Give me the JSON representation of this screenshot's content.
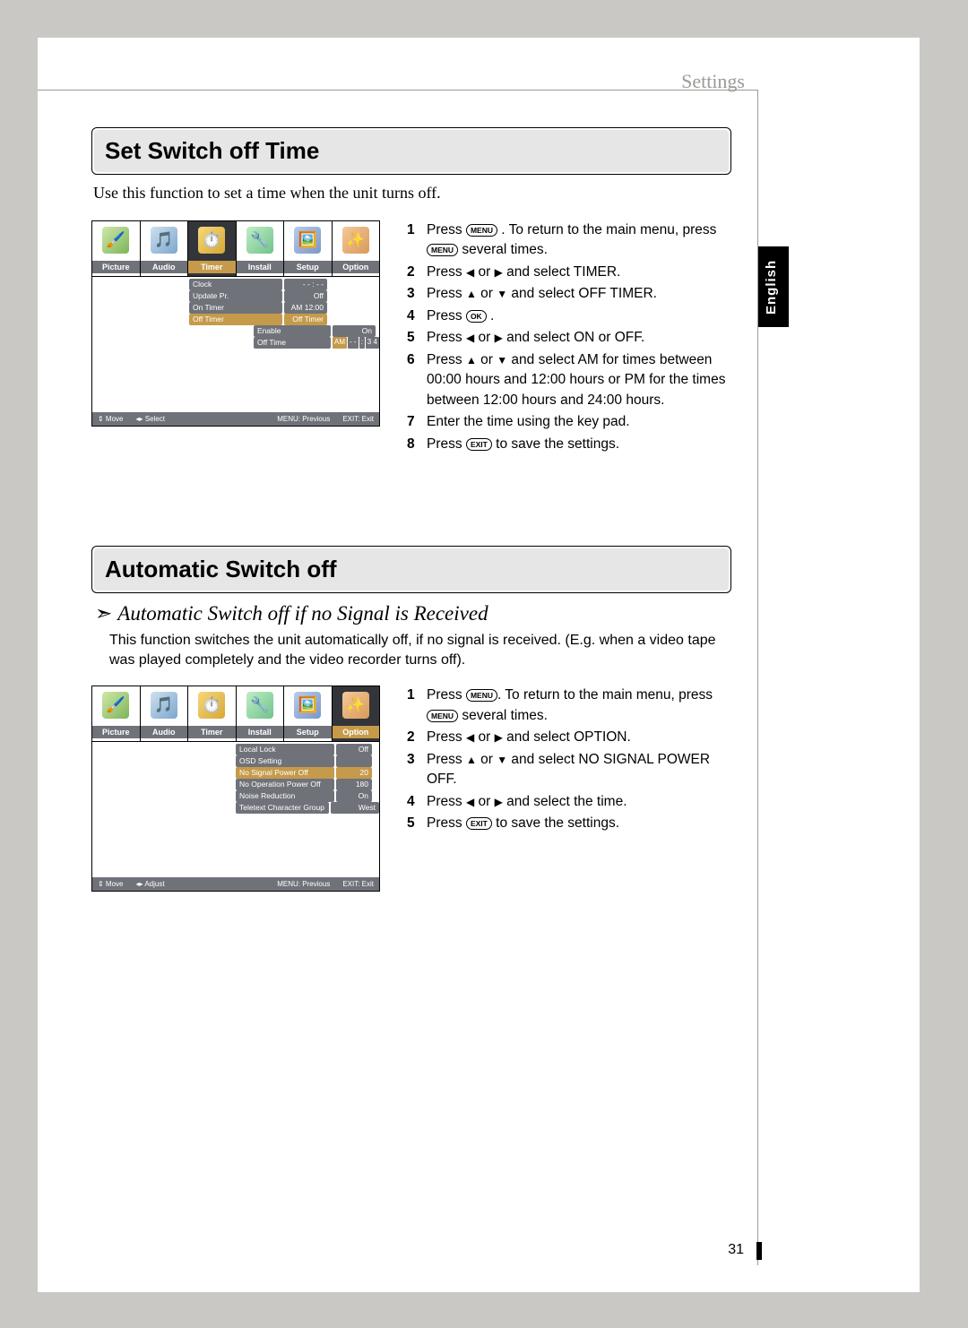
{
  "header": {
    "section": "Settings",
    "language": "English",
    "page_number": "31"
  },
  "section1": {
    "title": "Set Switch off Time",
    "intro": "Use this function to set a time when the unit turns off.",
    "osd": {
      "tabs": [
        "Picture",
        "Audio",
        "Timer",
        "Install",
        "Setup",
        "Option"
      ],
      "active_tab": 2,
      "rows": [
        {
          "label": "Clock",
          "value": "- - : - -"
        },
        {
          "label": "Update Pr.",
          "value": "Off"
        },
        {
          "label": "On Timer",
          "value": "AM 12:00"
        },
        {
          "label": "Off Timer",
          "value": "Off Timer",
          "hl": true
        }
      ],
      "subrows": [
        {
          "label": "Enable",
          "value": "On"
        },
        {
          "label": "Off Time",
          "pieces": [
            "AM",
            "- -",
            ":",
            "3 4"
          ]
        }
      ],
      "footer": [
        "⇕ Move",
        "◂▸ Select",
        "MENU: Previous",
        "EXIT: Exit"
      ]
    },
    "steps": [
      {
        "n": "1",
        "t": "Press |MENU| . To return to the main menu, press |MENU| several times."
      },
      {
        "n": "2",
        "t": "Press ◀ or ▶ and select TIMER."
      },
      {
        "n": "3",
        "t": "Press ▲ or ▼ and select OFF TIMER."
      },
      {
        "n": "4",
        "t": "Press |OK| ."
      },
      {
        "n": "5",
        "t": "Press ◀ or ▶ and select ON or OFF."
      },
      {
        "n": "6",
        "t": "Press ▲ or ▼ and select AM for times between 00:00 hours and 12:00 hours or PM for the times between 12:00 hours and 24:00 hours."
      },
      {
        "n": "7",
        "t": "Enter the time using the key pad."
      },
      {
        "n": "8",
        "t": "Press |EXIT| to save the settings."
      }
    ]
  },
  "section2": {
    "title": "Automatic Switch off",
    "subhead": "Automatic Switch off if no Signal is Received",
    "intro": "This function switches the unit automatically off, if no signal is received. (E.g. when a video tape was played completely and the video recorder turns off).",
    "osd": {
      "tabs": [
        "Picture",
        "Audio",
        "Timer",
        "Install",
        "Setup",
        "Option"
      ],
      "active_tab": 5,
      "rows": [
        {
          "label": "Local Lock",
          "value": "Off"
        },
        {
          "label": "OSD Setting",
          "value": ""
        },
        {
          "label": "No Signal Power Off",
          "value": "20",
          "hl": true
        },
        {
          "label": "No Operation Power Off",
          "value": "180"
        },
        {
          "label": "Noise Reduction",
          "value": "On"
        },
        {
          "label": "Teletext Character Group",
          "value": "West Europe"
        }
      ],
      "footer": [
        "⇕ Move",
        "◂▸ Adjust",
        "MENU: Previous",
        "EXIT: Exit"
      ]
    },
    "steps": [
      {
        "n": "1",
        "t": "Press |MENU|. To return to the main menu, press |MENU| several times."
      },
      {
        "n": "2",
        "t": "Press ◀ or ▶ and select OPTION."
      },
      {
        "n": "3",
        "t": "Press ▲ or ▼ and select NO SIGNAL POWER OFF."
      },
      {
        "n": "4",
        "t": "Press ◀ or ▶ and select the time."
      },
      {
        "n": "5",
        "t": "Press  |EXIT| to save the settings."
      }
    ]
  }
}
